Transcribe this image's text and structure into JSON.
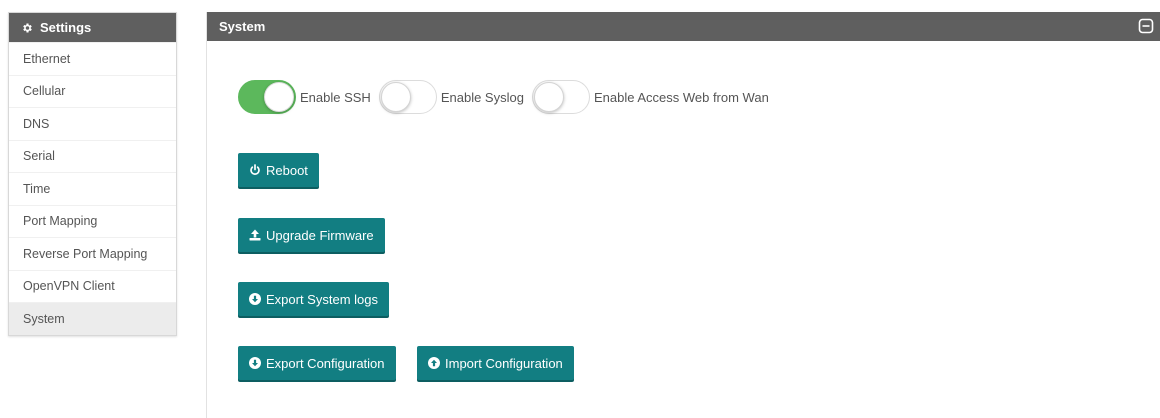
{
  "sidebar": {
    "title": "Settings",
    "icon": "gear-icon",
    "items": [
      {
        "label": "Ethernet"
      },
      {
        "label": "Cellular"
      },
      {
        "label": "DNS"
      },
      {
        "label": "Serial"
      },
      {
        "label": "Time"
      },
      {
        "label": "Port Mapping"
      },
      {
        "label": "Reverse Port Mapping"
      },
      {
        "label": "OpenVPN Client"
      },
      {
        "label": "System",
        "active": true
      }
    ]
  },
  "panel": {
    "title": "System",
    "collapse_icon": "minus-square-icon",
    "toggles": [
      {
        "label": "Enable SSH",
        "on": true
      },
      {
        "label": "Enable Syslog",
        "on": false
      },
      {
        "label": "Enable Access Web from Wan",
        "on": false
      }
    ],
    "buttons": {
      "reboot": {
        "label": "Reboot",
        "icon": "power-icon"
      },
      "upgrade": {
        "label": "Upgrade Firmware",
        "icon": "upload-icon"
      },
      "export_logs": {
        "label": "Export System logs",
        "icon": "download-circle-icon"
      },
      "export_config": {
        "label": "Export Configuration",
        "icon": "download-circle-icon"
      },
      "import_config": {
        "label": "Import Configuration",
        "icon": "upload-circle-icon"
      }
    }
  },
  "colors": {
    "header_bg": "#5f5f5f",
    "button_bg": "#127e82",
    "toggle_on": "#5cb85c",
    "active_item_bg": "#ececec"
  }
}
